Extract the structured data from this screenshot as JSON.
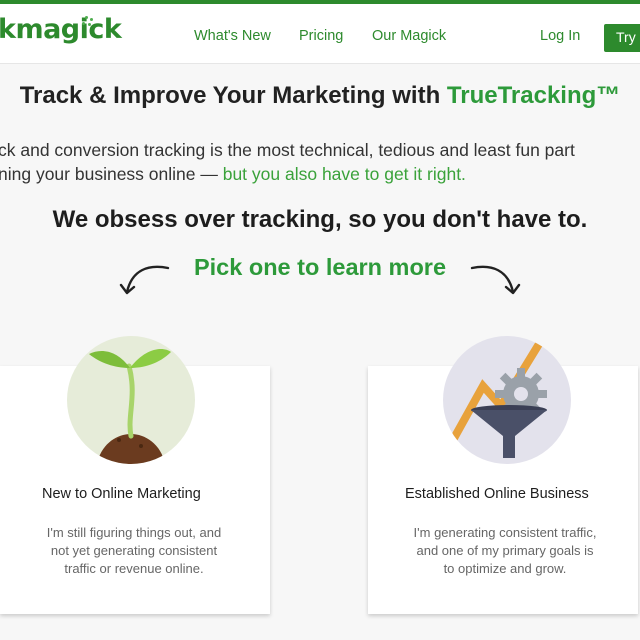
{
  "header": {
    "logo_text": "kmagick",
    "nav": [
      "What's New",
      "Pricing",
      "Our Magick"
    ],
    "login_label": "Log In",
    "try_label": "Try"
  },
  "hero": {
    "title_prefix": "Track & Improve Your Marketing with ",
    "title_accent": "TrueTracking™",
    "intro_line1": "ck and conversion tracking is the most technical, tedious and least fun part",
    "intro_line2_prefix": "ning your business online — ",
    "intro_line2_green": "but you also have to get it right."
  },
  "obsess_text": "We obsess over tracking, so you don't have to.",
  "pick_text": "Pick one to learn more",
  "cards": [
    {
      "title": "New to Online Marketing",
      "icon": "sprout-icon",
      "desc_lines": [
        "I'm still figuring things out, and",
        "not yet generating consistent",
        "traffic or revenue online."
      ]
    },
    {
      "title": "Established Online Business",
      "icon": "funnel-gear-icon",
      "desc_lines": [
        "I'm generating consistent traffic,",
        "and one of my primary goals is",
        "to optimize and grow."
      ]
    }
  ],
  "colors": {
    "brand_green": "#2d8a2d",
    "accent_green": "#2d9a3a",
    "text_dark": "#1d1d1d",
    "muted": "#666666"
  }
}
